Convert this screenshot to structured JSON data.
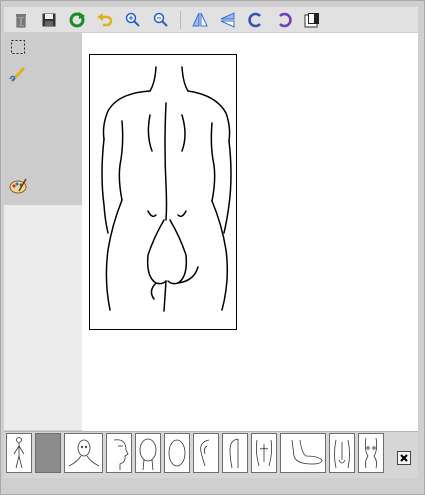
{
  "toolbar": {
    "buttons": [
      {
        "icon": "clear-icon"
      },
      {
        "icon": "save-icon"
      },
      {
        "icon": "refresh-icon"
      },
      {
        "icon": "undo-icon"
      },
      {
        "icon": "zoom-in-icon"
      },
      {
        "icon": "zoom-out-icon"
      },
      {
        "icon": "flip-vertical-icon"
      },
      {
        "icon": "flip-horizontal-icon"
      },
      {
        "icon": "rotate-left-icon"
      },
      {
        "icon": "rotate-right-icon"
      },
      {
        "icon": "color-fill-icon"
      }
    ]
  },
  "tools": [
    {
      "icon": "rectangle-select-icon"
    },
    {
      "icon": "pencil-icon"
    },
    {
      "icon": "palette-icon"
    }
  ],
  "canvas": {
    "image": "body-back-figure"
  },
  "gallery": {
    "selected_index": 1,
    "thumbnails": [
      {
        "icon": "standing-figure-thumb"
      },
      {
        "icon": "blank-gray-thumb"
      },
      {
        "icon": "head-shoulders-thumb"
      },
      {
        "icon": "face-profile-thumb"
      },
      {
        "icon": "head-back-thumb"
      },
      {
        "icon": "face-oval-thumb"
      },
      {
        "icon": "ear-thumb"
      },
      {
        "icon": "ear-outline-thumb"
      },
      {
        "icon": "torso-front-thumb"
      },
      {
        "icon": "foot-thumb"
      },
      {
        "icon": "back-torso-thumb"
      },
      {
        "icon": "female-torso-thumb"
      }
    ]
  },
  "colors": {
    "accent_green": "#1a8d2a",
    "accent_blue": "#3a6fd8",
    "accent_yellow": "#e0b020"
  }
}
